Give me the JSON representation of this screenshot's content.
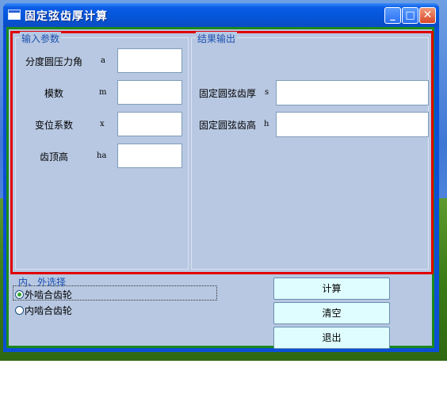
{
  "window": {
    "title": "固定弦齿厚计算",
    "controls": [
      "minimize",
      "maximize",
      "close"
    ]
  },
  "input_group": {
    "legend": "输入参数",
    "fields": [
      {
        "label": "分度圆压力角",
        "symbol": "a",
        "value": ""
      },
      {
        "label": "模数",
        "symbol": "m",
        "value": ""
      },
      {
        "label": "变位系数",
        "symbol": "x",
        "value": ""
      },
      {
        "label": "齿顶高",
        "symbol": "ha",
        "value": ""
      }
    ]
  },
  "output_group": {
    "legend": "结果输出",
    "fields": [
      {
        "label": "固定圆弦齿厚",
        "symbol": "s",
        "value": ""
      },
      {
        "label": "固定圆弦齿高",
        "symbol": "h",
        "value": ""
      }
    ]
  },
  "gear_select": {
    "legend": "内、外选择",
    "options": [
      {
        "label": "外啮合齿轮",
        "selected": true
      },
      {
        "label": "内啮合齿轮",
        "selected": false
      }
    ]
  },
  "buttons": {
    "calculate": "计算",
    "clear": "清空",
    "exit": "退出"
  }
}
